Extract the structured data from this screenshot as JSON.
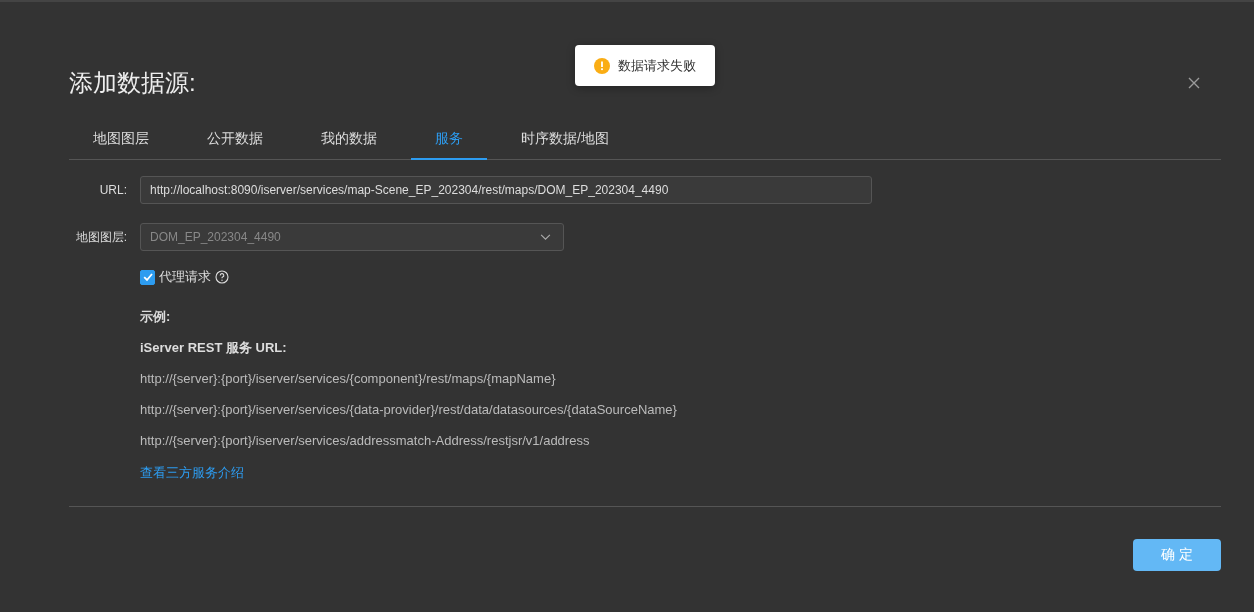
{
  "toast": {
    "text": "数据请求失败"
  },
  "dialog": {
    "title": "添加数据源:",
    "tabs": [
      {
        "label": "地图图层",
        "selected": false
      },
      {
        "label": "公开数据",
        "selected": false
      },
      {
        "label": "我的数据",
        "selected": false
      },
      {
        "label": "服务",
        "selected": true
      },
      {
        "label": "时序数据/地图",
        "selected": false
      }
    ],
    "url": {
      "label": "URL:",
      "value": "http://localhost:8090/iserver/services/map-Scene_EP_202304/rest/maps/DOM_EP_202304_4490"
    },
    "layer": {
      "label": "地图图层:",
      "value": "DOM_EP_202304_4490"
    },
    "proxy": {
      "label": "代理请求",
      "checked": true
    },
    "example_heading": "示例:",
    "example_subheading": "iServer REST 服务 URL:",
    "examples": [
      "http://{server}:{port}/iserver/services/{component}/rest/maps/{mapName}",
      "http://{server}:{port}/iserver/services/{data-provider}/rest/data/datasources/{dataSourceName}",
      "http://{server}:{port}/iserver/services/addressmatch-Address/restjsr/v1/address"
    ],
    "link": "查看三方服务介绍",
    "confirm_button": "确 定"
  }
}
